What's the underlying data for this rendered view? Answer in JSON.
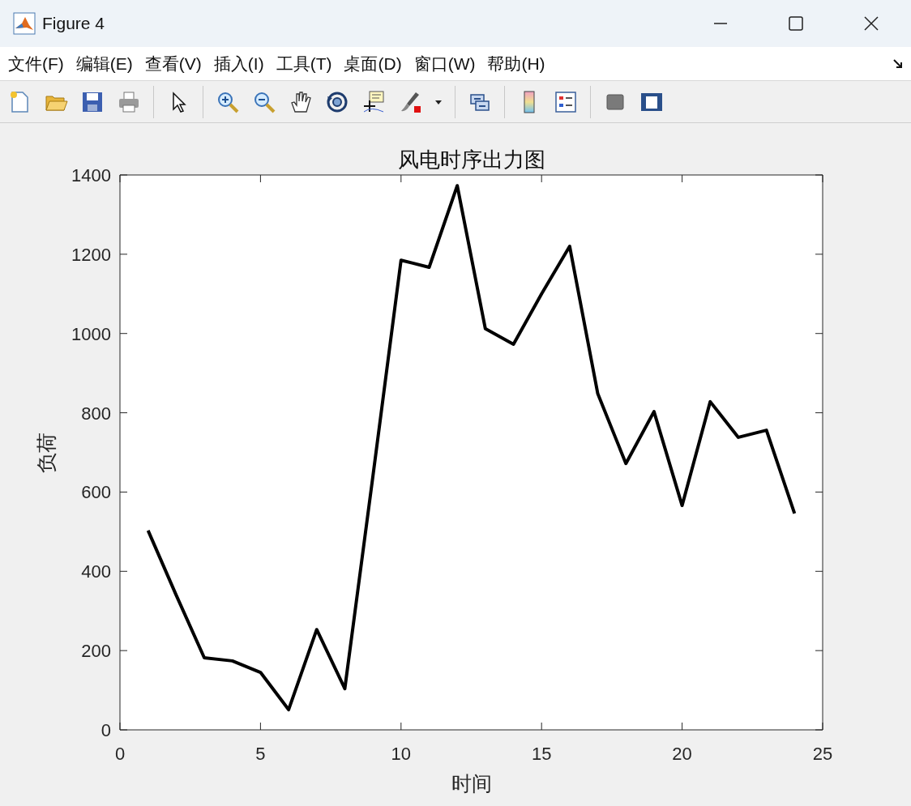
{
  "window": {
    "title": "Figure 4"
  },
  "menu": [
    {
      "label": "文件(F)"
    },
    {
      "label": "编辑(E)"
    },
    {
      "label": "查看(V)"
    },
    {
      "label": "插入(I)"
    },
    {
      "label": "工具(T)"
    },
    {
      "label": "桌面(D)"
    },
    {
      "label": "窗口(W)"
    },
    {
      "label": "帮助(H)"
    }
  ],
  "figure": {
    "chart_data": {
      "type": "line",
      "title": "风电时序出力图",
      "xlabel": "时间",
      "ylabel": "负荷",
      "x": [
        1,
        2,
        3,
        4,
        5,
        6,
        7,
        8,
        9,
        10,
        11,
        12,
        13,
        14,
        15,
        16,
        17,
        18,
        19,
        20,
        21,
        22,
        23,
        24
      ],
      "series": [
        {
          "color": "#000000",
          "values": [
            503,
            340,
            182,
            174,
            145,
            51,
            253,
            104,
            640,
            1185,
            1167,
            1373,
            1012,
            973,
            1100,
            1220,
            848,
            672,
            803,
            566,
            828,
            738,
            756,
            546
          ]
        }
      ],
      "xlim": [
        0,
        25
      ],
      "ylim": [
        0,
        1400
      ],
      "xticks": [
        0,
        5,
        10,
        15,
        20,
        25
      ],
      "yticks": [
        0,
        200,
        400,
        600,
        800,
        1000,
        1200,
        1400
      ]
    }
  }
}
